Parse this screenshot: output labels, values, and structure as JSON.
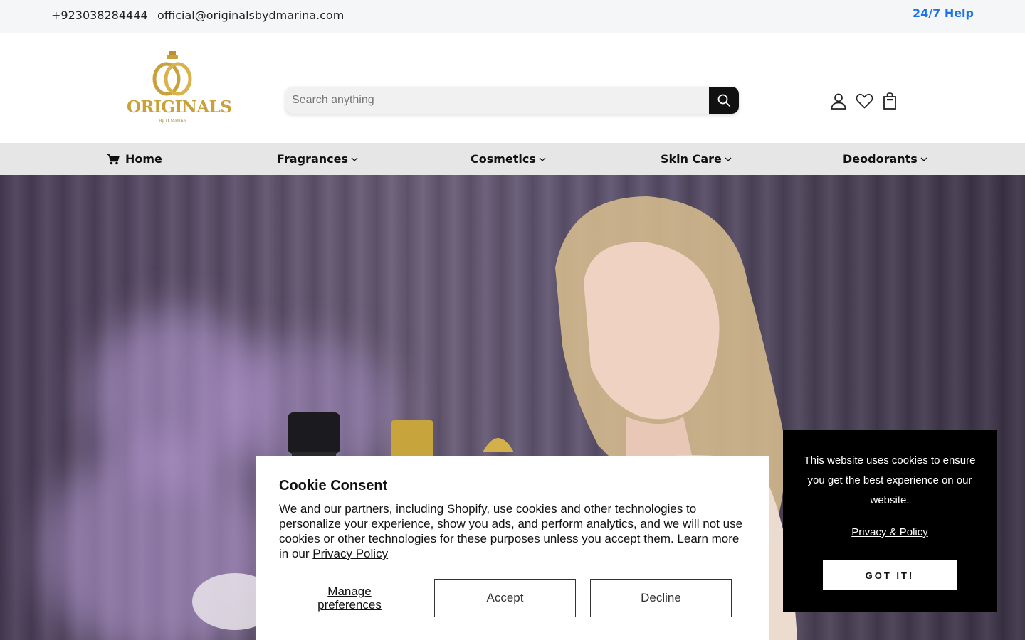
{
  "topbar": {
    "phone": "+923038284444",
    "email": "official@originalsbydmarina.com",
    "help": "24/7 Help"
  },
  "brand": {
    "name": "ORIGINALS",
    "sub": "By D.Marina",
    "color": "#c9a13b"
  },
  "search": {
    "placeholder": "Search anything",
    "icon": "search-icon"
  },
  "header_icons": [
    "user-icon",
    "heart-icon",
    "shopping-bag-icon"
  ],
  "nav": {
    "home": "Home",
    "fragrances": "Fragrances",
    "cosmetics": "Cosmetics",
    "skin_care": "Skin Care",
    "deodorants": "Deodorants"
  },
  "consent": {
    "title": "Cookie Consent",
    "body": "We and our partners, including Shopify, use cookies and other technologies to personalize your experience, show you ads, and perform analytics, and we will not use cookies or other technologies for these purposes unless you accept them. Learn more in our",
    "policy_link": "Privacy Policy",
    "manage": "Manage preferences",
    "accept": "Accept",
    "decline": "Decline"
  },
  "notice": {
    "message": "This website uses cookies to ensure you get the best experience on our website.",
    "policy": "Privacy & Policy",
    "button": "GOT IT!"
  },
  "colors": {
    "accent": "#1a73e8",
    "nav_bg": "#e6e6e6",
    "topbar_bg": "#f5f6f8"
  }
}
